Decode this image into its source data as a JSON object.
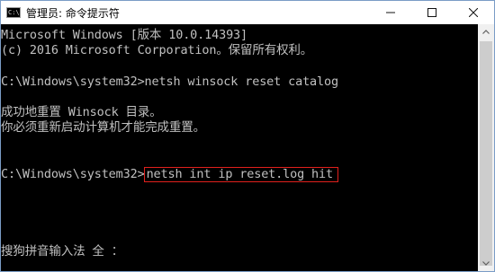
{
  "window": {
    "title": "管理员: 命令提示符",
    "icon": "cmd-icon",
    "icon_glyph": "C:\\",
    "controls": [
      "minimize-icon",
      "maximize-icon",
      "close-icon"
    ]
  },
  "console": {
    "lines": [
      "Microsoft Windows [版本 10.0.14393]",
      "(c) 2016 Microsoft Corporation。保留所有权利。",
      "",
      "C:\\Windows\\system32>netsh winsock reset catalog",
      "",
      "成功地重置 Winsock 目录。",
      "你必须重新启动计算机才能完成重置。",
      "",
      "",
      "C:\\Windows\\system32>",
      "",
      "",
      "",
      "",
      "搜狗拼音输入法 全 ："
    ],
    "highlighted_command": "netsh int ip reset.log hit",
    "highlight_color": "#e0201c",
    "text_color": "#c0c0c0",
    "background_color": "#000000"
  },
  "scrollbar": {
    "up_icon": "chevron-up-icon",
    "down_icon": "chevron-down-icon"
  }
}
